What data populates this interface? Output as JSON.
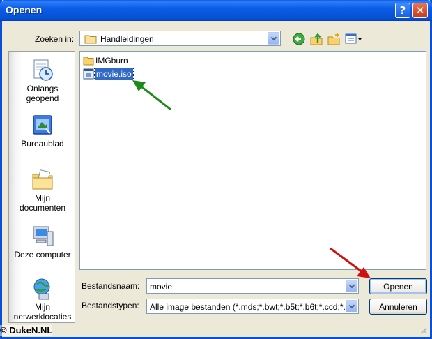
{
  "window": {
    "title": "Openen"
  },
  "lookin": {
    "label": "Zoeken in:",
    "value": "Handleidingen"
  },
  "places": [
    {
      "label_1": "Onlangs",
      "label_2": "geopend",
      "icon": "recent-documents-icon"
    },
    {
      "label_1": "Bureaublad",
      "label_2": "",
      "icon": "desktop-icon"
    },
    {
      "label_1": "Mijn",
      "label_2": "documenten",
      "icon": "my-documents-icon"
    },
    {
      "label_1": "Deze computer",
      "label_2": "",
      "icon": "my-computer-icon"
    },
    {
      "label_1": "Mijn",
      "label_2": "netwerklocaties",
      "icon": "network-places-icon"
    }
  ],
  "files": [
    {
      "name": "IMGburn",
      "type": "folder"
    },
    {
      "name": "movie.iso",
      "type": "iso",
      "selected": true
    }
  ],
  "filename": {
    "label": "Bestandsnaam:",
    "value": "movie"
  },
  "filetype": {
    "label": "Bestandstypen:",
    "value": "Alle image bestanden (*.mds;*.bwt;*.b5t;*.b6t;*.ccd;*.i"
  },
  "buttons": {
    "open": "Openen",
    "cancel": "Annuleren"
  },
  "watermark": "© DukeN.NL",
  "colors": {
    "titlebar": "#0a5ce8",
    "selection": "#316ac5",
    "annotation_green": "#1a8a1a",
    "annotation_red": "#d01010"
  }
}
